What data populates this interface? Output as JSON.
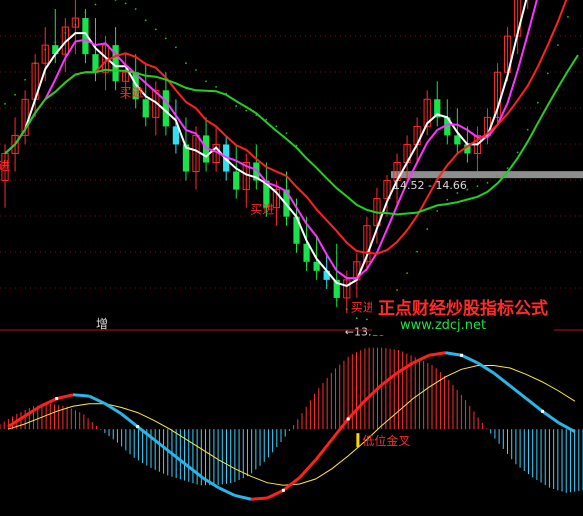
{
  "chart_data": [
    {
      "type": "candlestick",
      "panel": "price",
      "colors": {
        "up": "#ff2a2a",
        "down": "#19e34b",
        "down_alt": "#2ee0f0"
      },
      "candles": [
        [
          14.6,
          15.0,
          14.3,
          14.9
        ],
        [
          14.9,
          15.3,
          14.7,
          15.1
        ],
        [
          15.1,
          15.6,
          15.0,
          15.5
        ],
        [
          15.5,
          16.0,
          15.3,
          15.9
        ],
        [
          15.9,
          16.3,
          15.7,
          16.1
        ],
        [
          16.1,
          16.5,
          15.9,
          16.0
        ],
        [
          16.0,
          16.4,
          15.8,
          16.3
        ],
        [
          16.3,
          16.6,
          16.0,
          16.4
        ],
        [
          16.4,
          16.5,
          15.9,
          16.0
        ],
        [
          16.0,
          16.4,
          15.7,
          15.8
        ],
        [
          15.8,
          16.2,
          15.6,
          16.1
        ],
        [
          16.1,
          16.3,
          15.6,
          15.7
        ],
        [
          15.7,
          16.0,
          15.5,
          15.8
        ],
        [
          15.8,
          16.0,
          15.4,
          15.5
        ],
        [
          15.5,
          15.9,
          15.2,
          15.3
        ],
        [
          15.3,
          15.7,
          15.1,
          15.6
        ],
        [
          15.6,
          15.8,
          15.1,
          15.2
        ],
        [
          15.2,
          15.5,
          14.9,
          15.0
        ],
        [
          15.0,
          15.3,
          14.6,
          14.7
        ],
        [
          14.7,
          15.2,
          14.5,
          15.1
        ],
        [
          15.1,
          15.3,
          14.7,
          14.8
        ],
        [
          14.8,
          15.2,
          14.7,
          15.0
        ],
        [
          15.0,
          15.1,
          14.6,
          14.7
        ],
        [
          14.7,
          15.0,
          14.4,
          14.5
        ],
        [
          14.5,
          14.9,
          14.3,
          14.8
        ],
        [
          14.8,
          15.0,
          14.5,
          14.6
        ],
        [
          14.6,
          14.8,
          14.2,
          14.3
        ],
        [
          14.3,
          14.6,
          14.1,
          14.5
        ],
        [
          14.5,
          14.7,
          14.1,
          14.2
        ],
        [
          14.2,
          14.4,
          13.8,
          13.9
        ],
        [
          13.9,
          14.2,
          13.6,
          13.7
        ],
        [
          13.7,
          14.0,
          13.5,
          13.6
        ],
        [
          13.6,
          13.8,
          13.4,
          13.5
        ],
        [
          13.5,
          13.9,
          13.2,
          13.3
        ],
        [
          13.3,
          13.6,
          13.13,
          13.5
        ],
        [
          13.5,
          13.8,
          13.3,
          13.7
        ],
        [
          13.7,
          14.2,
          13.6,
          14.1
        ],
        [
          14.1,
          14.52,
          13.9,
          14.4
        ],
        [
          14.4,
          14.66,
          14.2,
          14.6
        ],
        [
          14.6,
          14.9,
          14.3,
          14.8
        ],
        [
          14.8,
          15.1,
          14.6,
          15.0
        ],
        [
          15.0,
          15.3,
          14.8,
          15.2
        ],
        [
          15.2,
          15.6,
          15.1,
          15.5
        ],
        [
          15.5,
          15.7,
          15.2,
          15.3
        ],
        [
          15.3,
          15.5,
          15.0,
          15.1
        ],
        [
          15.1,
          15.4,
          14.9,
          15.0
        ],
        [
          15.0,
          15.2,
          14.8,
          14.9
        ],
        [
          14.9,
          15.2,
          14.7,
          15.1
        ],
        [
          15.1,
          15.4,
          15.0,
          15.3
        ],
        [
          15.3,
          15.9,
          15.2,
          15.8
        ],
        [
          15.8,
          16.3,
          15.7,
          16.2
        ],
        [
          16.2,
          16.8,
          16.0,
          16.7
        ],
        [
          16.7,
          17.2,
          16.5,
          17.1
        ],
        [
          17.1,
          17.5,
          16.9,
          17.4
        ],
        [
          17.4,
          17.6,
          17.1,
          17.5
        ],
        [
          17.5,
          17.8,
          17.2,
          17.6
        ],
        [
          17.6,
          17.9,
          17.3,
          17.8
        ],
        [
          17.8,
          18.0,
          17.5,
          17.9
        ]
      ],
      "ylim": [
        13.0,
        16.6
      ],
      "annotations": [
        {
          "text": "买进",
          "kind": "buy_signal"
        },
        {
          "text": "买进",
          "kind": "buy_signal"
        },
        {
          "text": "买进",
          "kind": "buy_signal"
        },
        {
          "text": "←13.13",
          "kind": "low_marker"
        },
        {
          "text": "14.52 - 14.66",
          "kind": "gap_marker"
        }
      ],
      "side_glyph": "进",
      "watermark": {
        "line1": "正点财经炒股指标公式",
        "line2": "www.zdcj.net"
      }
    },
    {
      "type": "macd",
      "panel": "indicator",
      "title": "增",
      "series": [
        {
          "color": "#e8e8e8",
          "values": [
            0.02,
            0.1,
            0.18,
            0.24,
            0.27,
            0.26,
            0.2,
            0.12,
            0.02,
            -0.08,
            -0.18,
            -0.28,
            -0.38,
            -0.46,
            -0.52,
            -0.55,
            -0.54,
            -0.48,
            -0.38,
            -0.24,
            -0.08,
            0.08,
            0.22,
            0.34,
            0.44,
            0.52,
            0.58,
            0.6,
            0.58,
            0.52,
            0.44,
            0.34,
            0.24,
            0.14,
            0.05,
            -0.02
          ]
        },
        {
          "color": "#ffe94a",
          "values": [
            0.0,
            0.04,
            0.09,
            0.14,
            0.18,
            0.2,
            0.2,
            0.17,
            0.13,
            0.07,
            0.0,
            -0.08,
            -0.16,
            -0.24,
            -0.31,
            -0.37,
            -0.42,
            -0.44,
            -0.43,
            -0.39,
            -0.31,
            -0.21,
            -0.1,
            0.02,
            0.13,
            0.24,
            0.33,
            0.41,
            0.47,
            0.5,
            0.5,
            0.48,
            0.43,
            0.37,
            0.3,
            0.22
          ]
        }
      ],
      "histogram_colors": {
        "positive": "#ff3030",
        "negative": "#39d3ff"
      },
      "annotations": [
        {
          "text": "低位金叉",
          "kind": "golden_cross"
        }
      ],
      "ylim": [
        -0.65,
        0.7
      ]
    }
  ]
}
